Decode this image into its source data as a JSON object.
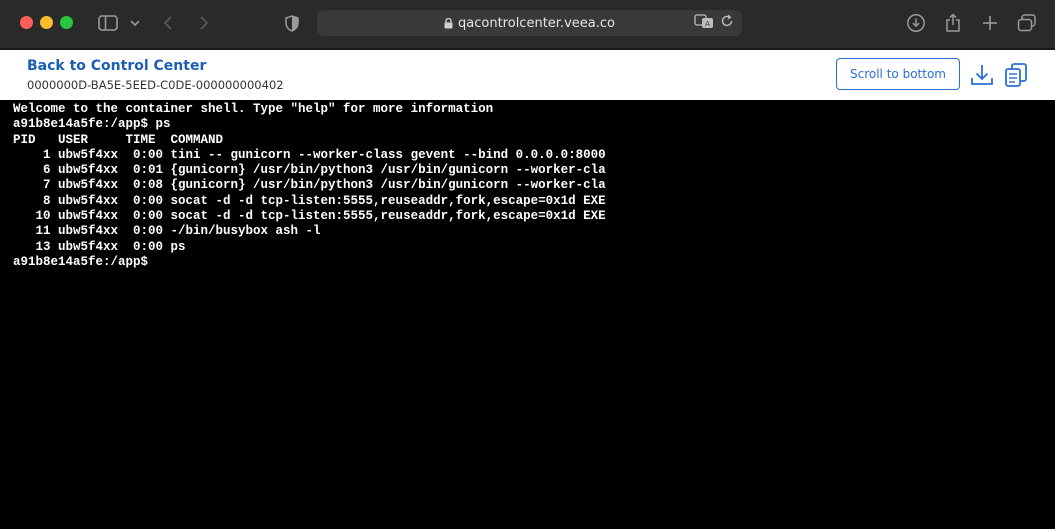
{
  "browser": {
    "url": "qacontrolcenter.veea.co",
    "icons": [
      "sidebar-icon",
      "chevron-down-icon",
      "back-icon",
      "forward-icon",
      "shield-icon",
      "lock-icon",
      "translate-icon",
      "reload-icon",
      "download-icon",
      "share-icon",
      "new-tab-icon",
      "tabs-overview-icon"
    ]
  },
  "header": {
    "back_label": "Back to Control Center",
    "device_id": "0000000D-BA5E-5EED-C0DE-000000000402",
    "scroll_label": "Scroll to bottom",
    "icons": [
      "download-icon",
      "copy-icon"
    ]
  },
  "terminal": {
    "lines": [
      "Welcome to the container shell. Type \"help\" for more information",
      "a91b8e14a5fe:/app$ ps",
      "PID   USER     TIME  COMMAND",
      "    1 ubw5f4xx  0:00 tini -- gunicorn --worker-class gevent --bind 0.0.0.0:8000",
      "    6 ubw5f4xx  0:01 {gunicorn} /usr/bin/python3 /usr/bin/gunicorn --worker-cla",
      "    7 ubw5f4xx  0:08 {gunicorn} /usr/bin/python3 /usr/bin/gunicorn --worker-cla",
      "    8 ubw5f4xx  0:00 socat -d -d tcp-listen:5555,reuseaddr,fork,escape=0x1d EXE",
      "   10 ubw5f4xx  0:00 socat -d -d tcp-listen:5555,reuseaddr,fork,escape=0x1d EXE",
      "   11 ubw5f4xx  0:00 -/bin/busybox ash -l",
      "   13 ubw5f4xx  0:00 ps",
      "a91b8e14a5fe:/app$"
    ]
  },
  "colors": {
    "link": "#1a5fb4",
    "button_border": "#2a6fd6",
    "terminal_bg": "#000000",
    "terminal_fg": "#ffffff"
  }
}
